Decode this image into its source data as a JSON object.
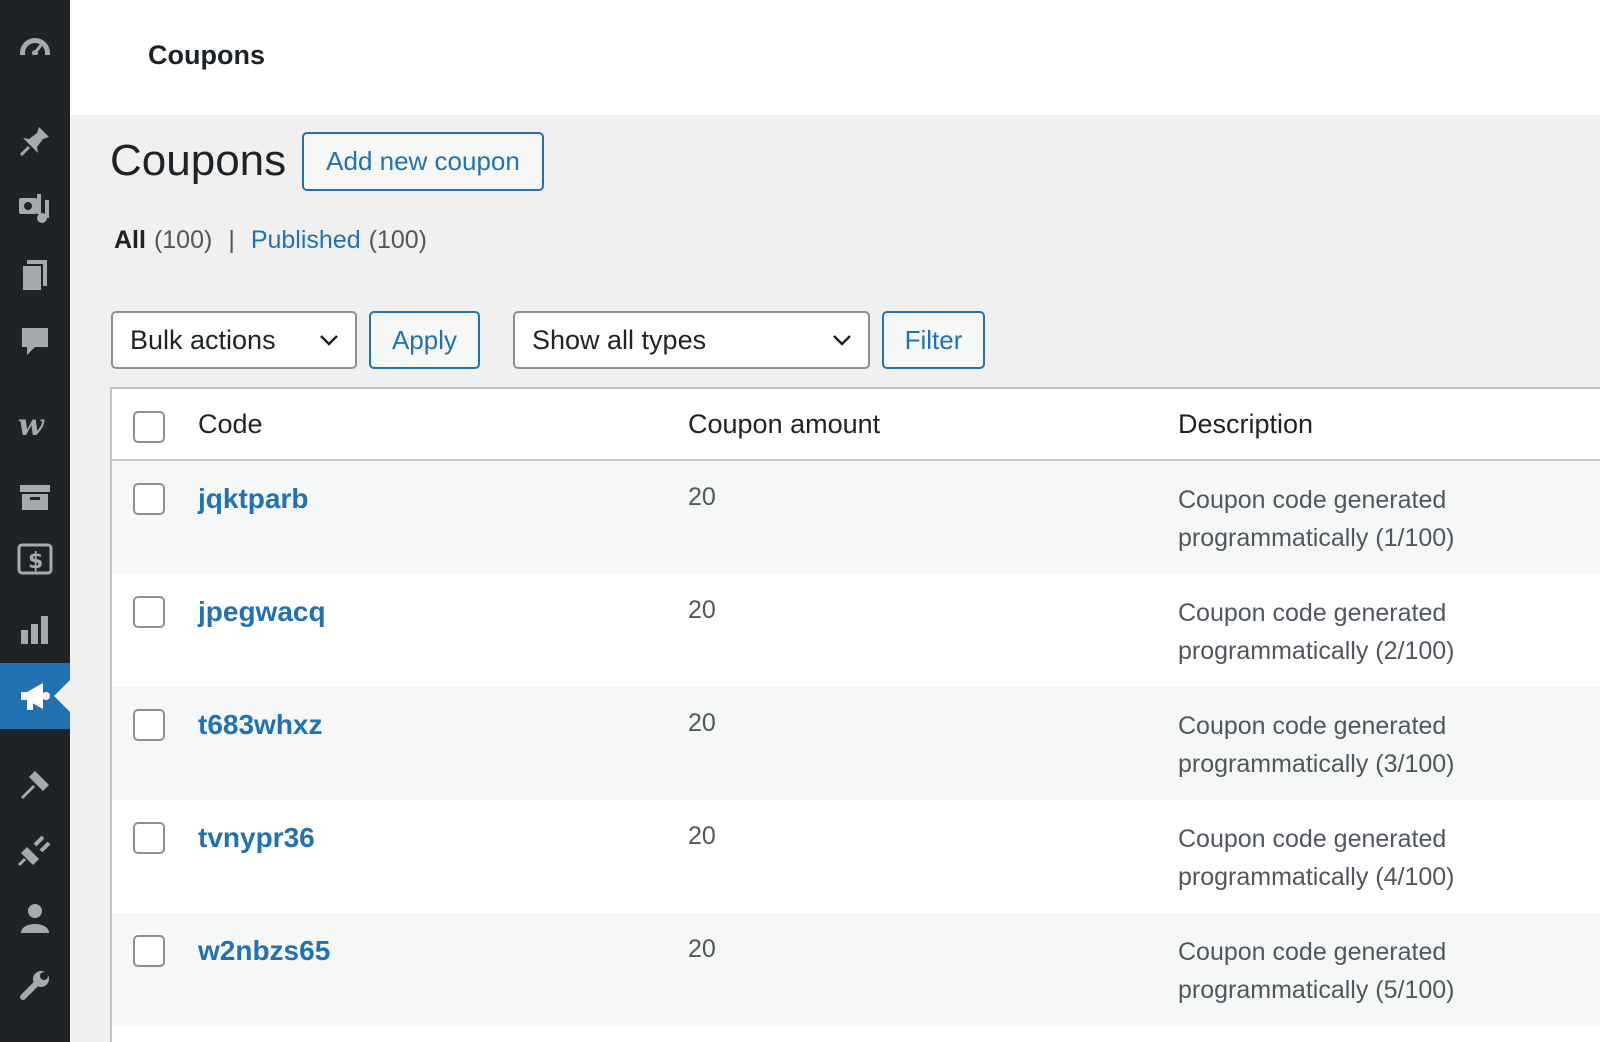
{
  "sidebar": {
    "items": [
      {
        "icon": "dashboard-icon"
      },
      {
        "icon": "pin-icon"
      },
      {
        "icon": "media-icon"
      },
      {
        "icon": "pages-icon"
      },
      {
        "icon": "comments-icon"
      },
      {
        "icon": "woocommerce-icon"
      },
      {
        "icon": "products-icon"
      },
      {
        "icon": "payments-icon"
      },
      {
        "icon": "analytics-icon"
      },
      {
        "icon": "marketing-icon",
        "active": true
      },
      {
        "icon": "appearance-icon"
      },
      {
        "icon": "plugins-icon"
      },
      {
        "icon": "users-icon"
      },
      {
        "icon": "tools-icon"
      }
    ]
  },
  "header": {
    "title": "Coupons"
  },
  "page": {
    "title": "Coupons",
    "add_button": "Add new coupon"
  },
  "views": {
    "all_label": "All",
    "all_count": "(100)",
    "separator": "|",
    "published_label": "Published",
    "published_count": "(100)"
  },
  "toolbar": {
    "bulk_actions": "Bulk actions",
    "apply": "Apply",
    "type_filter": "Show all types",
    "filter": "Filter"
  },
  "table": {
    "columns": [
      "Code",
      "Coupon amount",
      "Description"
    ],
    "rows": [
      {
        "code": "jqktparb",
        "amount": "20",
        "desc1": "Coupon code generated",
        "desc2": "programmatically (1/100)"
      },
      {
        "code": "jpegwacq",
        "amount": "20",
        "desc1": "Coupon code generated",
        "desc2": "programmatically (2/100)"
      },
      {
        "code": "t683whxz",
        "amount": "20",
        "desc1": "Coupon code generated",
        "desc2": "programmatically (3/100)"
      },
      {
        "code": "tvnypr36",
        "amount": "20",
        "desc1": "Coupon code generated",
        "desc2": "programmatically (4/100)"
      },
      {
        "code": "w2nbzs65",
        "amount": "20",
        "desc1": "Coupon code generated",
        "desc2": "programmatically (5/100)"
      }
    ]
  },
  "colors": {
    "sidebar_bg": "#1d2327",
    "accent": "#2271b1",
    "icon": "#a7aaad"
  }
}
